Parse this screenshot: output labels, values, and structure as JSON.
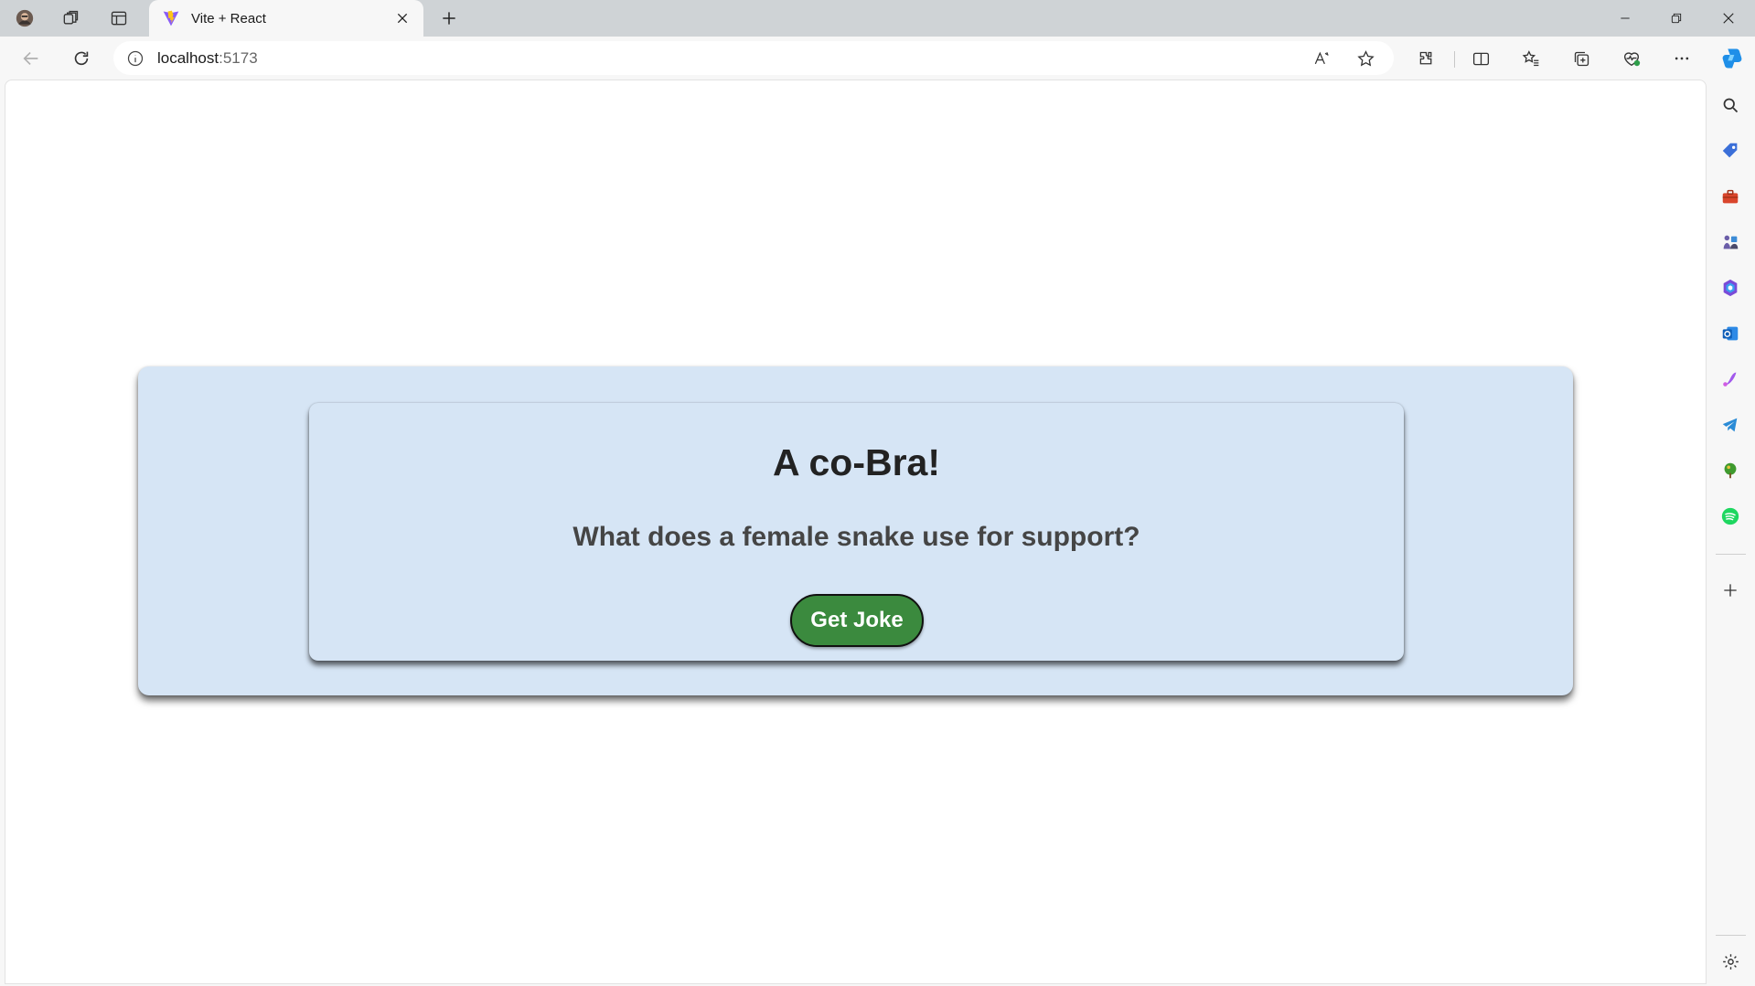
{
  "browser": {
    "tab": {
      "title": "Vite + React"
    },
    "address": {
      "host": "localhost",
      "port": ":5173"
    }
  },
  "icons": {
    "tabstrip": [
      "profile-avatar-icon",
      "workspaces-icon",
      "vertical-tabs-icon"
    ],
    "toolbar": [
      "back-icon",
      "refresh-icon",
      "site-info-icon",
      "read-aloud-icon",
      "favorite-star-icon",
      "extensions-icon",
      "split-screen-icon",
      "favorites-icon",
      "collections-icon",
      "browser-essentials-icon",
      "more-options-icon",
      "copilot-icon"
    ],
    "sidebar": [
      "search-icon",
      "shopping-tag-icon",
      "tools-icon",
      "games-icon",
      "microsoft-365-icon",
      "outlook-icon",
      "designer-icon",
      "telegram-icon",
      "tree-app-icon",
      "spotify-icon",
      "add-icon",
      "settings-icon"
    ]
  },
  "app": {
    "punchline": "A co-Bra!",
    "setup": "What does a female snake use for support?",
    "button_label": "Get Joke"
  },
  "colors": {
    "card_background": "#d6e5f5",
    "button_background": "#3b8a3e",
    "button_text": "#ffffff"
  }
}
